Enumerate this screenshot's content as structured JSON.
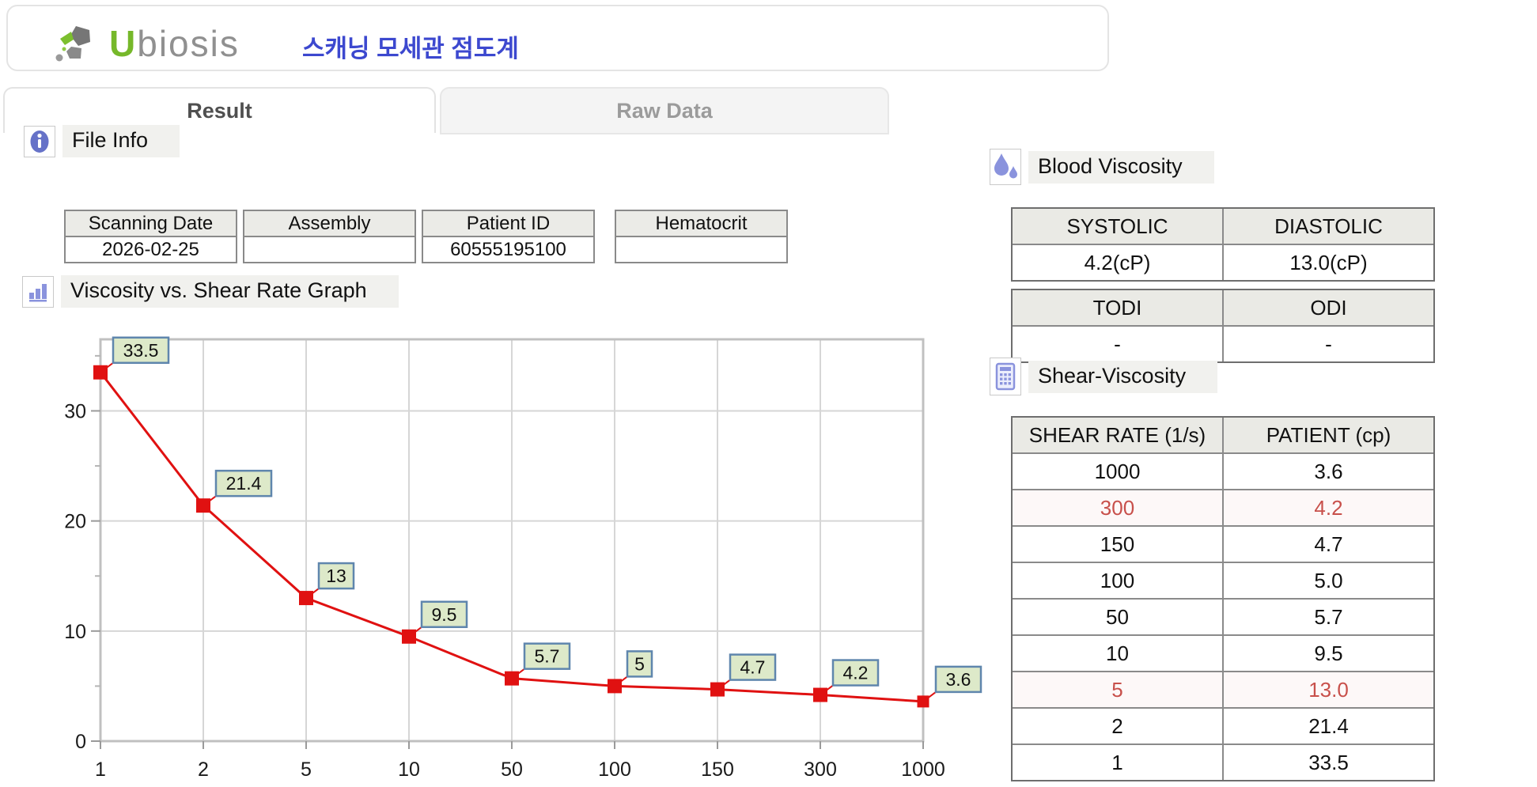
{
  "header": {
    "logo_u": "U",
    "logo_rest": "biosis",
    "app_title": "스캐닝 모세관 점도계"
  },
  "tabs": [
    {
      "label": "Result",
      "active": true
    },
    {
      "label": "Raw Data",
      "active": false
    }
  ],
  "file_info": {
    "section_title": "File Info",
    "fields": [
      {
        "label": "Scanning Date",
        "value": "2026-02-25"
      },
      {
        "label": "Assembly",
        "value": ""
      },
      {
        "label": "Patient ID",
        "value": "60555195100"
      },
      {
        "label": "Hematocrit",
        "value": ""
      }
    ]
  },
  "graph_section": {
    "title": "Viscosity vs. Shear Rate Graph"
  },
  "chart_data": {
    "type": "line",
    "title": "Viscosity vs. Shear Rate Graph",
    "categories": [
      "1",
      "2",
      "5",
      "10",
      "50",
      "100",
      "150",
      "300",
      "1000"
    ],
    "values": [
      33.5,
      21.4,
      13,
      9.5,
      5.7,
      5,
      4.7,
      4.2,
      3.6
    ],
    "point_labels": [
      "33.5",
      "21.4",
      "13",
      "9.5",
      "5.7",
      "5",
      "4.7",
      "4.2",
      "3.6"
    ],
    "xlabel": "",
    "ylabel": "",
    "ylim": [
      0,
      36.5
    ],
    "yticks": [
      0,
      10,
      20,
      30
    ],
    "minor_yticks": [
      5,
      15,
      25,
      35
    ],
    "grid": true,
    "legend": false,
    "marker": "square"
  },
  "blood_viscosity": {
    "section_title": "Blood Viscosity",
    "table1": {
      "headers": [
        "SYSTOLIC",
        "DIASTOLIC"
      ],
      "values": [
        "4.2(cP)",
        "13.0(cP)"
      ]
    },
    "table2": {
      "headers": [
        "TODI",
        "ODI"
      ],
      "values": [
        "-",
        "-"
      ]
    }
  },
  "shear_viscosity": {
    "section_title": "Shear-Viscosity",
    "headers": [
      "SHEAR RATE (1/s)",
      "PATIENT (cp)"
    ],
    "rows": [
      {
        "rate": "1000",
        "patient": "3.6",
        "highlight": false
      },
      {
        "rate": "300",
        "patient": "4.2",
        "highlight": true
      },
      {
        "rate": "150",
        "patient": "4.7",
        "highlight": false
      },
      {
        "rate": "100",
        "patient": "5.0",
        "highlight": false
      },
      {
        "rate": "50",
        "patient": "5.7",
        "highlight": false
      },
      {
        "rate": "10",
        "patient": "9.5",
        "highlight": false
      },
      {
        "rate": "5",
        "patient": "13.0",
        "highlight": true
      },
      {
        "rate": "2",
        "patient": "21.4",
        "highlight": false
      },
      {
        "rate": "1",
        "patient": "33.5",
        "highlight": false
      }
    ]
  },
  "colors": {
    "accent_red": "#c8504b",
    "series_red": "#e01111",
    "label_box_bg": "#dde9c9",
    "label_box_border": "#5f86ad",
    "grid_gray": "#d6d6d6",
    "plot_border": "#c0c0c0",
    "title_blue": "#3c48cf",
    "logo_green": "#76b82a",
    "icon_purple": "#8a93dd"
  }
}
